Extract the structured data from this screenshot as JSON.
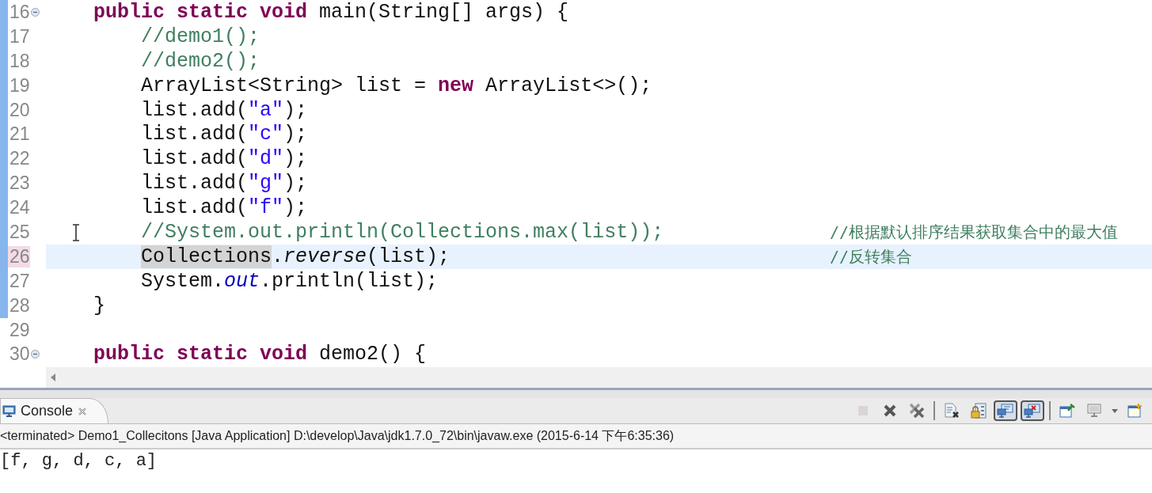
{
  "editor": {
    "lines": [
      {
        "number": "16",
        "fold": true,
        "current": false,
        "scope": true,
        "tokens": [
          {
            "kind": "kw",
            "text": "    public static void"
          },
          {
            "kind": "plain",
            "text": " main(String[] args) {"
          }
        ]
      },
      {
        "number": "17",
        "fold": false,
        "current": false,
        "scope": true,
        "tokens": [
          {
            "kind": "comment",
            "text": "        //demo1();"
          }
        ]
      },
      {
        "number": "18",
        "fold": false,
        "current": false,
        "scope": true,
        "tokens": [
          {
            "kind": "comment",
            "text": "        //demo2();"
          }
        ]
      },
      {
        "number": "19",
        "fold": false,
        "current": false,
        "scope": true,
        "tokens": [
          {
            "kind": "plain",
            "text": "        ArrayList<String> list = "
          },
          {
            "kind": "kw",
            "text": "new"
          },
          {
            "kind": "plain",
            "text": " ArrayList<>();"
          }
        ]
      },
      {
        "number": "20",
        "fold": false,
        "current": false,
        "scope": true,
        "tokens": [
          {
            "kind": "plain",
            "text": "        list.add("
          },
          {
            "kind": "str",
            "text": "\"a\""
          },
          {
            "kind": "plain",
            "text": ");"
          }
        ]
      },
      {
        "number": "21",
        "fold": false,
        "current": false,
        "scope": true,
        "tokens": [
          {
            "kind": "plain",
            "text": "        list.add("
          },
          {
            "kind": "str",
            "text": "\"c\""
          },
          {
            "kind": "plain",
            "text": ");"
          }
        ]
      },
      {
        "number": "22",
        "fold": false,
        "current": false,
        "scope": true,
        "tokens": [
          {
            "kind": "plain",
            "text": "        list.add("
          },
          {
            "kind": "str",
            "text": "\"d\""
          },
          {
            "kind": "plain",
            "text": ");"
          }
        ]
      },
      {
        "number": "23",
        "fold": false,
        "current": false,
        "scope": true,
        "tokens": [
          {
            "kind": "plain",
            "text": "        list.add("
          },
          {
            "kind": "str",
            "text": "\"g\""
          },
          {
            "kind": "plain",
            "text": ");"
          }
        ]
      },
      {
        "number": "24",
        "fold": false,
        "current": false,
        "scope": true,
        "tokens": [
          {
            "kind": "plain",
            "text": "        list.add("
          },
          {
            "kind": "str",
            "text": "\"f\""
          },
          {
            "kind": "plain",
            "text": ");"
          }
        ]
      },
      {
        "number": "25",
        "fold": false,
        "current": false,
        "scope": true,
        "tokens": [
          {
            "kind": "comment",
            "text": "        //System.out.println(Collections.max(list));"
          }
        ],
        "trailing_comment": "//根据默认排序结果获取集合中的最大值"
      },
      {
        "number": "26",
        "fold": false,
        "current": true,
        "scope": true,
        "tokens": [
          {
            "kind": "occurrence",
            "text": "        Collections"
          },
          {
            "kind": "plain",
            "text": "."
          },
          {
            "kind": "italic",
            "text": "reverse"
          },
          {
            "kind": "plain",
            "text": "(list);"
          }
        ],
        "trailing_comment": "//反转集合"
      },
      {
        "number": "27",
        "fold": false,
        "current": false,
        "scope": true,
        "tokens": [
          {
            "kind": "plain",
            "text": "        System."
          },
          {
            "kind": "field",
            "text": "out"
          },
          {
            "kind": "plain",
            "text": ".println(list);"
          }
        ]
      },
      {
        "number": "28",
        "fold": false,
        "current": false,
        "scope": true,
        "tokens": [
          {
            "kind": "plain",
            "text": "    }"
          }
        ]
      },
      {
        "number": "29",
        "fold": false,
        "current": false,
        "scope": false
      },
      {
        "number": "30",
        "fold": true,
        "current": false,
        "scope": false,
        "tokens": [
          {
            "kind": "kw",
            "text": "    public static void"
          },
          {
            "kind": "plain",
            "text": " demo2() {"
          }
        ]
      }
    ]
  },
  "console": {
    "tab": {
      "label": "Console",
      "selected": true
    },
    "toolbar": [
      {
        "kind": "terminate",
        "pressed": false,
        "disabled": true
      },
      {
        "kind": "remove",
        "pressed": false,
        "disabled": false
      },
      {
        "kind": "remove-all",
        "pressed": false,
        "disabled": false
      },
      {
        "kind": "separator",
        "pressed": false,
        "disabled": false
      },
      {
        "kind": "clear",
        "pressed": false,
        "disabled": false
      },
      {
        "kind": "lock",
        "pressed": false,
        "disabled": false
      },
      {
        "kind": "output",
        "pressed": true,
        "disabled": false
      },
      {
        "kind": "error",
        "pressed": true,
        "disabled": false
      },
      {
        "kind": "separator",
        "pressed": false,
        "disabled": false
      },
      {
        "kind": "pin",
        "pressed": false,
        "disabled": false
      },
      {
        "kind": "display",
        "pressed": false,
        "disabled": false
      },
      {
        "kind": "caret",
        "pressed": false,
        "disabled": false
      },
      {
        "kind": "new",
        "pressed": false,
        "disabled": false
      }
    ],
    "header": "<terminated> Demo1_Collecitons [Java Application] D:\\develop\\Java\\jdk1.7.0_72\\bin\\javaw.exe (2015-6-14 下午6:35:36)",
    "output": [
      "[f, g, d, c, a]"
    ]
  }
}
